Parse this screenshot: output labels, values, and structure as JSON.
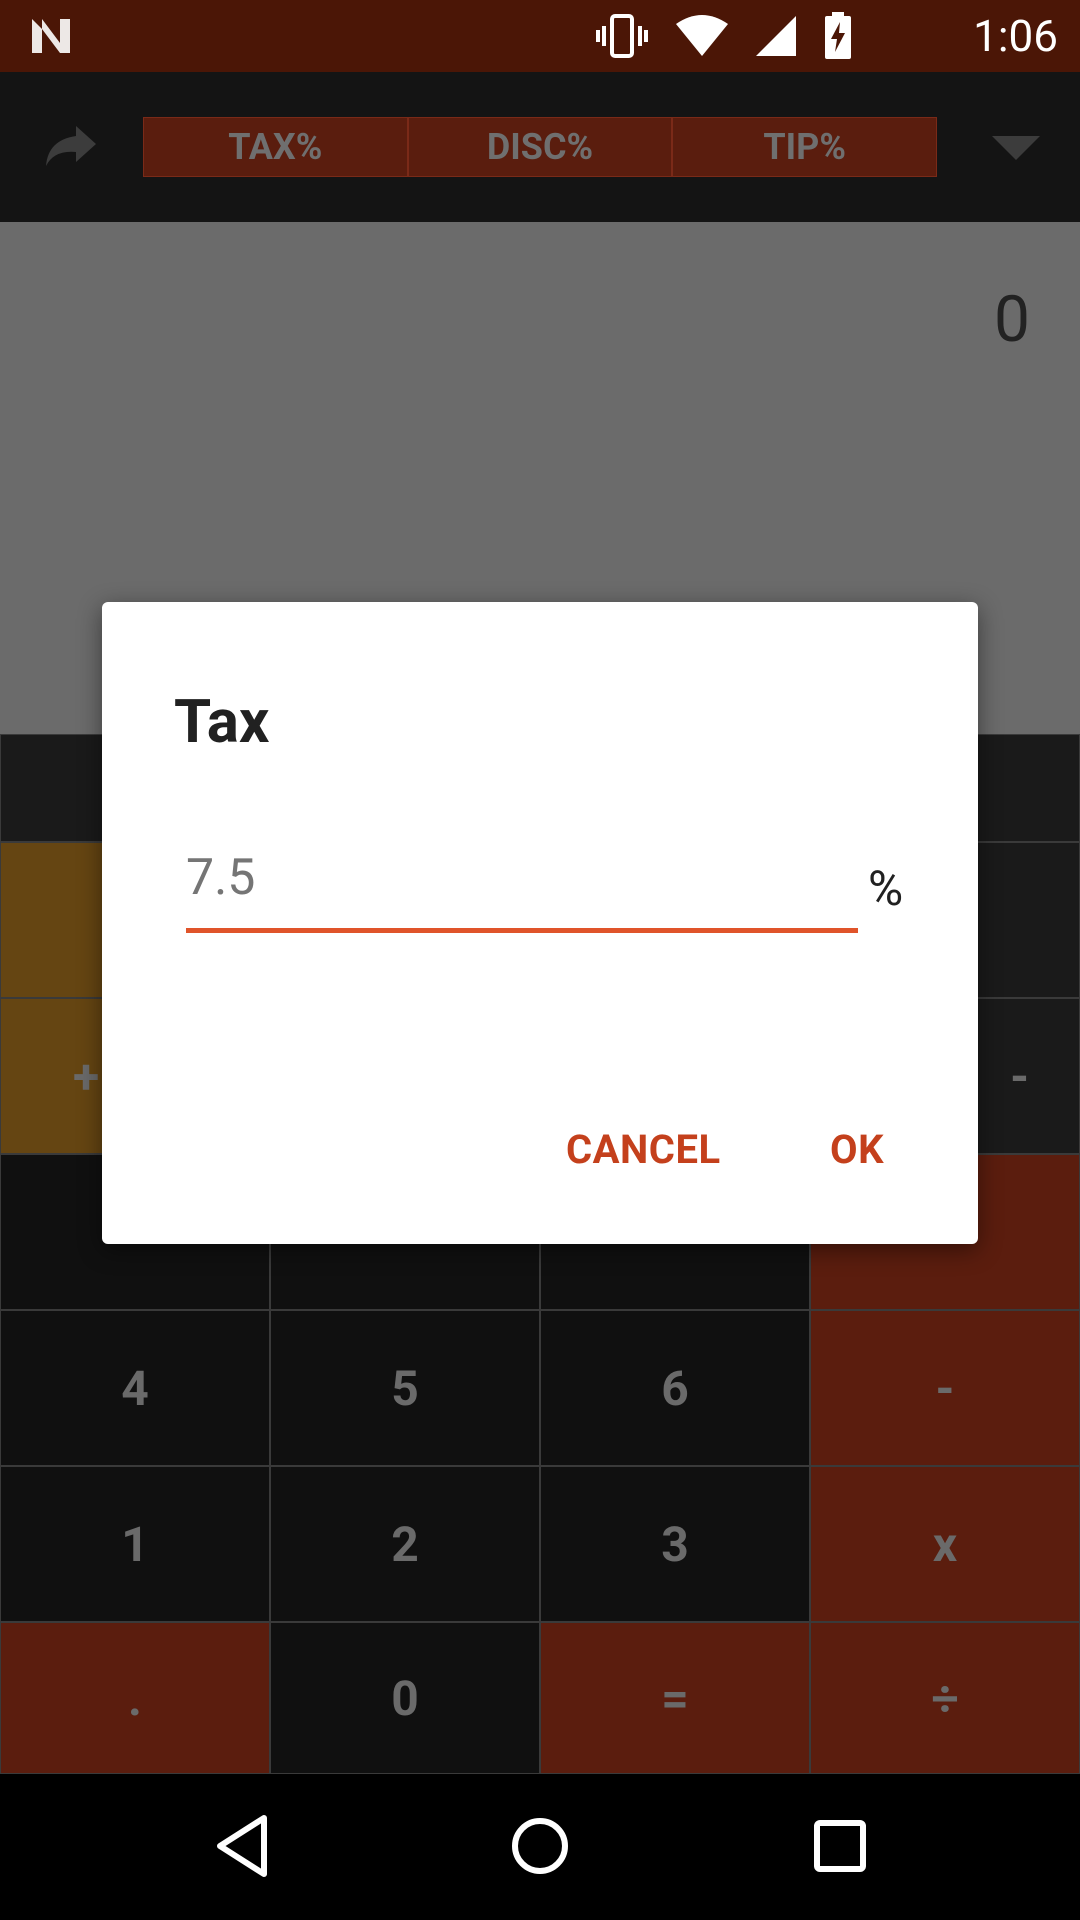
{
  "status_bar": {
    "time": "1:06",
    "icons": [
      "n-logo-icon",
      "vibrate-icon",
      "wifi-icon",
      "signal-icon",
      "battery-charging-icon"
    ]
  },
  "toolbar": {
    "tabs": [
      "TAX%",
      "DISC%",
      "TIP%"
    ],
    "icons": [
      "redo-icon",
      "dropdown-triangle-icon"
    ]
  },
  "display": {
    "value": "0"
  },
  "keypad": {
    "row_plus": "+",
    "row_minus": "-",
    "keys": {
      "k4": "4",
      "k5": "5",
      "k6": "6",
      "ksub": "-",
      "k1": "1",
      "k2": "2",
      "k3": "3",
      "kmul": "x",
      "kdot": ".",
      "k0": "0",
      "keq": "=",
      "kdiv": "÷"
    }
  },
  "dialog": {
    "title": "Tax",
    "input_placeholder": "7.5",
    "suffix": "%",
    "cancel_label": "CANCEL",
    "ok_label": "OK"
  },
  "colors": {
    "accent": "#e0542a",
    "button_text": "#c4401c",
    "status_bar": "#4b1606"
  }
}
